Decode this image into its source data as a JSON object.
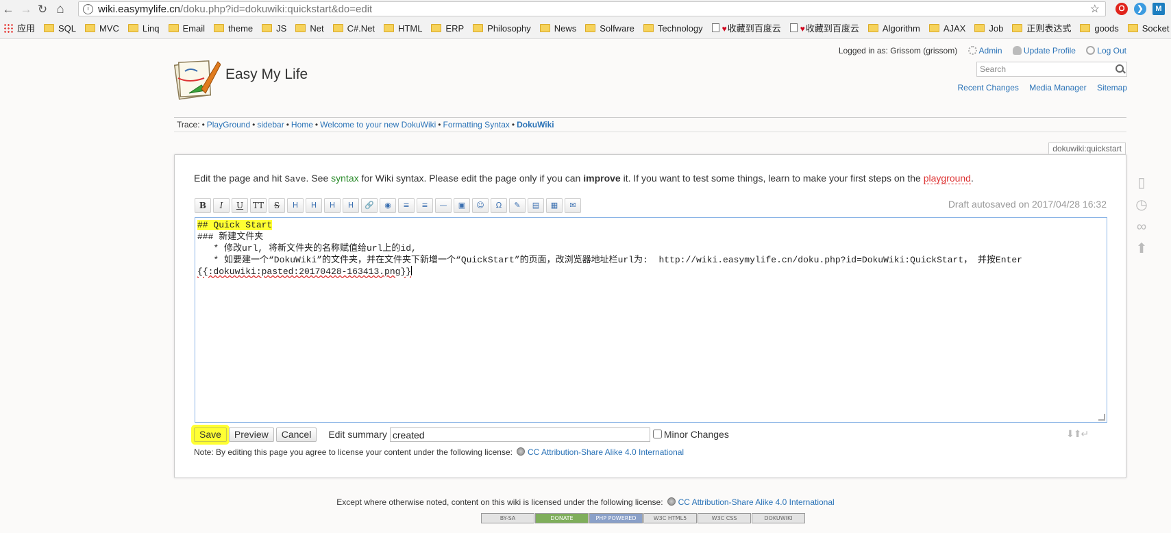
{
  "browser": {
    "url_host": "wiki.easymylife.cn",
    "url_path": "/doku.php?id=dokuwiki:quickstart&do=edit",
    "back_glyph": "←",
    "forward_glyph": "→",
    "reload_glyph": "↻",
    "home_glyph": "⌂",
    "star_glyph": "☆",
    "ext1_glyph": "Ｏ",
    "ext2_glyph": "❯",
    "ext3_glyph": "M",
    "bookmarks": [
      {
        "label": "应用",
        "icon": "apps"
      },
      {
        "label": "SQL",
        "icon": "folder"
      },
      {
        "label": "MVC",
        "icon": "folder"
      },
      {
        "label": "Linq",
        "icon": "folder"
      },
      {
        "label": "Email",
        "icon": "folder"
      },
      {
        "label": "theme",
        "icon": "folder"
      },
      {
        "label": "JS",
        "icon": "folder"
      },
      {
        "label": "Net",
        "icon": "folder"
      },
      {
        "label": "C#.Net",
        "icon": "folder"
      },
      {
        "label": "HTML",
        "icon": "folder"
      },
      {
        "label": "ERP",
        "icon": "folder"
      },
      {
        "label": "Philosophy",
        "icon": "folder"
      },
      {
        "label": "News",
        "icon": "folder"
      },
      {
        "label": "Solfware",
        "icon": "folder"
      },
      {
        "label": "Technology",
        "icon": "folder"
      },
      {
        "label": "收藏到百度云",
        "icon": "doc-heart"
      },
      {
        "label": "收藏到百度云",
        "icon": "doc-heart"
      },
      {
        "label": "Algorithm",
        "icon": "folder"
      },
      {
        "label": "AJAX",
        "icon": "folder"
      },
      {
        "label": "Job",
        "icon": "folder"
      },
      {
        "label": "正则表达式",
        "icon": "folder"
      },
      {
        "label": "goods",
        "icon": "folder"
      },
      {
        "label": "Socket",
        "icon": "folder"
      }
    ]
  },
  "header": {
    "site_title": "Easy My Life",
    "logged_in": "Logged in as: Grissom (grissom)",
    "admin": "Admin",
    "update_profile": "Update Profile",
    "logout": "Log Out",
    "search_placeholder": "Search",
    "recent_changes": "Recent Changes",
    "media_manager": "Media Manager",
    "sitemap": "Sitemap"
  },
  "breadcrumbs": {
    "label": "Trace:",
    "sep": "•",
    "items": [
      "PlayGround",
      "sidebar",
      "Home",
      "Welcome to your new DokuWiki",
      "Formatting Syntax",
      "DokuWiki"
    ]
  },
  "page": {
    "page_id": "dokuwiki:quickstart",
    "intro_1": "Edit the page and hit ",
    "intro_save": "Save",
    "intro_2": ". See ",
    "intro_syntax": "syntax",
    "intro_3": " for Wiki syntax. Please edit the page only if you can ",
    "intro_improve": "improve",
    "intro_4": " it. If you want to test some things, learn to make your first steps on the ",
    "intro_playground": "playground",
    "intro_5": ".",
    "draft_status": "Draft autosaved on 2017/04/28 16:32",
    "toolbar": [
      "B",
      "I",
      "U",
      "TT",
      "S",
      "H",
      "H",
      "H",
      "H",
      "🔗",
      "◉",
      "≡",
      "≡",
      "—",
      "▣",
      "☺",
      "Ω",
      "✎",
      "▤",
      "▦",
      "✉"
    ],
    "editor_lines": [
      "## Quick Start",
      "### 新建文件夹",
      "   * 修改url, 将新文件夹的名称赋值给url上的id,",
      "   * 如要建一个“DokuWiki”的文件夹，并在文件夹下新增一个“QuickStart”的页面，改浏览器地址栏url为:  http://wiki.easymylife.cn/doku.php?id=DokuWiki:QuickStart， 并按Enter",
      "{{:dokuwiki:pasted:20170428-163413.png}}"
    ],
    "save": "Save",
    "preview": "Preview",
    "cancel": "Cancel",
    "summary_label": "Edit summary",
    "summary_value": "created",
    "minor_changes": "Minor Changes",
    "license_note": "Note: By editing this page you agree to license your content under the following license:",
    "license_link": "CC Attribution-Share Alike 4.0 International"
  },
  "footer": {
    "text": "Except where otherwise noted, content on this wiki is licensed under the following license:",
    "license_link": "CC Attribution-Share Alike 4.0 International",
    "badges": [
      "BY-SA",
      "DONATE",
      "PHP POWERED",
      "W3C HTML5",
      "W3C CSS",
      "DOKUWIKI"
    ]
  }
}
